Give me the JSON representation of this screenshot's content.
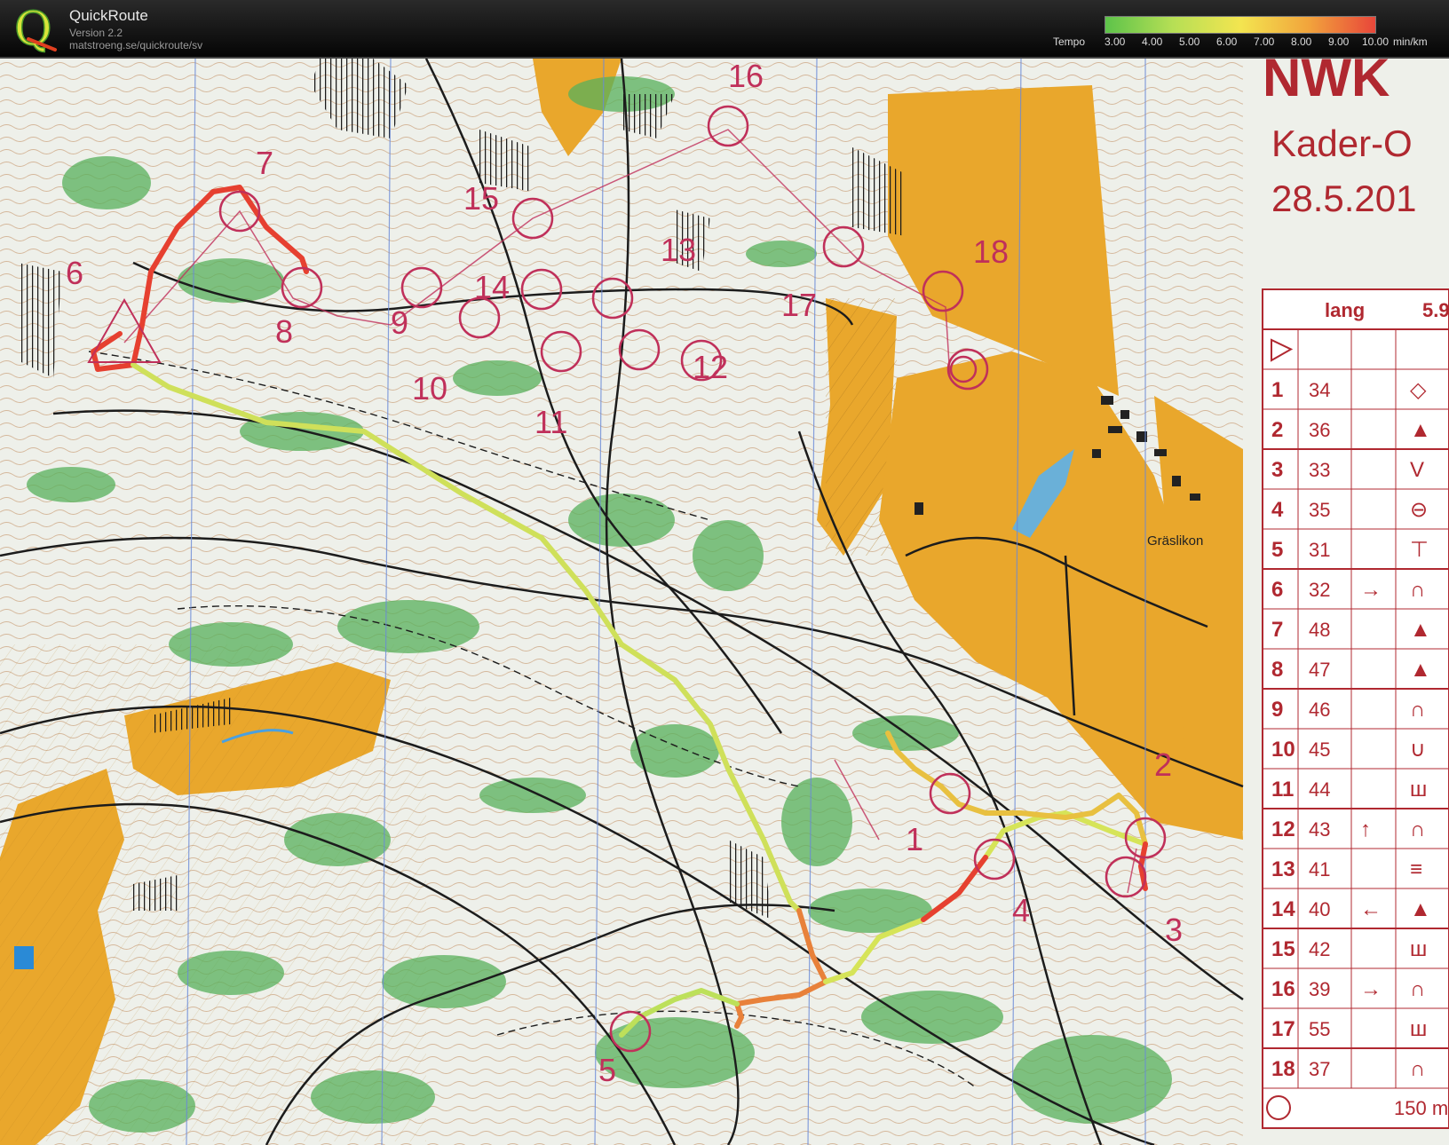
{
  "app": {
    "name": "QuickRoute",
    "version": "Version 2.2",
    "url": "matstroeng.se/quickroute/sv"
  },
  "legend": {
    "label": "Tempo",
    "ticks": [
      "3.00",
      "4.00",
      "5.00",
      "6.00",
      "7.00",
      "8.00",
      "9.00",
      "10.00"
    ],
    "unit": "min/km",
    "colors": [
      "#5dc34a",
      "#b6df55",
      "#f3e550",
      "#f2a53c",
      "#e8463a"
    ]
  },
  "map": {
    "header_title": "NWK",
    "subtitle": "Kader-O",
    "date": "28.5.201",
    "place_label": "Gräslikon",
    "controls_on_map": [
      "1",
      "2",
      "3",
      "4",
      "5",
      "6",
      "7",
      "8",
      "9",
      "10",
      "11",
      "12",
      "13",
      "14",
      "15",
      "16",
      "17",
      "18"
    ],
    "course_table": {
      "header": [
        "lang",
        "5.9"
      ],
      "rows": [
        {
          "num": "1",
          "code": "34",
          "dir": "",
          "sym": "◇"
        },
        {
          "num": "2",
          "code": "36",
          "dir": "",
          "sym": "▲"
        },
        {
          "num": "3",
          "code": "33",
          "dir": "",
          "sym": "V"
        },
        {
          "num": "4",
          "code": "35",
          "dir": "",
          "sym": "⊖"
        },
        {
          "num": "5",
          "code": "31",
          "dir": "",
          "sym": "⊤"
        },
        {
          "num": "6",
          "code": "32",
          "dir": "→",
          "sym": "∩"
        },
        {
          "num": "7",
          "code": "48",
          "dir": "",
          "sym": "▲"
        },
        {
          "num": "8",
          "code": "47",
          "dir": "",
          "sym": "▲"
        },
        {
          "num": "9",
          "code": "46",
          "dir": "",
          "sym": "∩"
        },
        {
          "num": "10",
          "code": "45",
          "dir": "",
          "sym": "∪"
        },
        {
          "num": "11",
          "code": "44",
          "dir": "",
          "sym": "ш"
        },
        {
          "num": "12",
          "code": "43",
          "dir": "↑",
          "sym": "∩"
        },
        {
          "num": "13",
          "code": "41",
          "dir": "",
          "sym": "≡"
        },
        {
          "num": "14",
          "code": "40",
          "dir": "←",
          "sym": "▲"
        },
        {
          "num": "15",
          "code": "42",
          "dir": "",
          "sym": "ш"
        },
        {
          "num": "16",
          "code": "39",
          "dir": "→",
          "sym": "∩"
        },
        {
          "num": "17",
          "code": "55",
          "dir": "",
          "sym": "ш"
        },
        {
          "num": "18",
          "code": "37",
          "dir": "",
          "sym": "∩"
        }
      ],
      "footer": "150 m"
    }
  }
}
